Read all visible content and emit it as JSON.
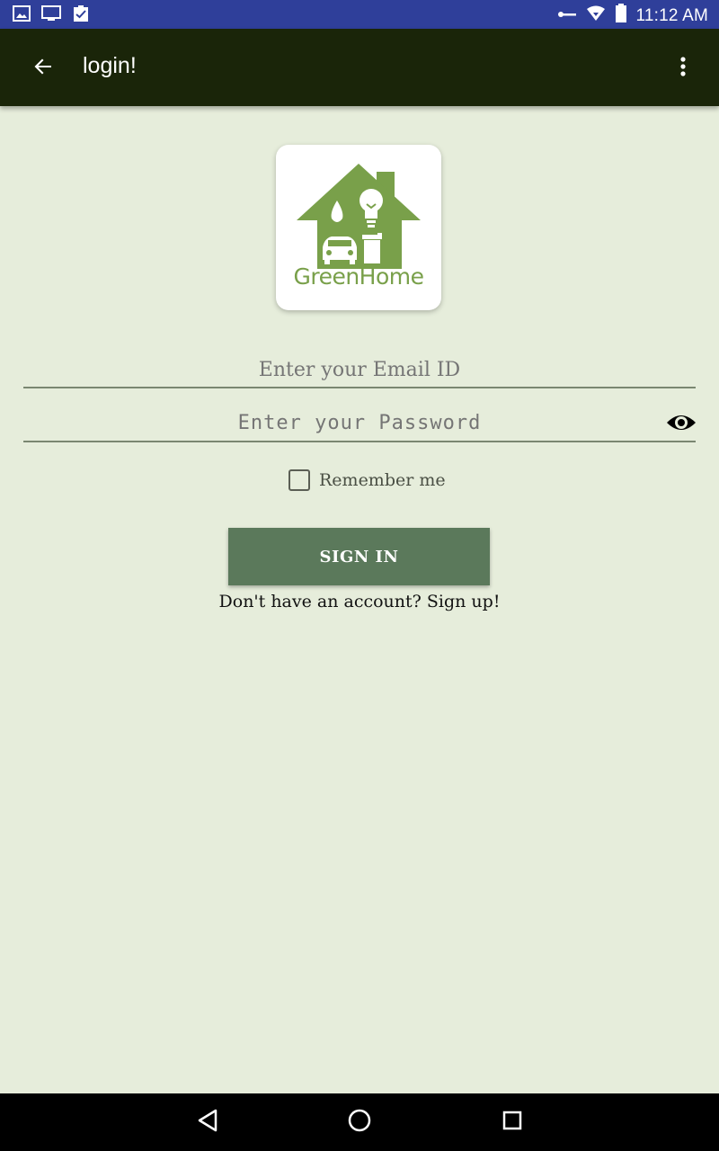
{
  "status_bar": {
    "time": "11:12 AM",
    "left_icons": [
      "image-icon",
      "monitor-icon",
      "clipboard-check-icon"
    ],
    "right_icons": [
      "key-icon",
      "wifi-icon",
      "battery-icon"
    ]
  },
  "app_bar": {
    "title": "login!",
    "back_icon": "arrow-left-icon",
    "menu_icon": "more-vert-icon"
  },
  "logo": {
    "text": "GreenHome",
    "color": "#79a04a"
  },
  "form": {
    "email_placeholder": "Enter your Email ID",
    "password_placeholder": "Enter your Password",
    "remember_label": "Remember me",
    "sign_in_label": "SIGN IN",
    "signup_link": "Don't have an account? Sign up!"
  },
  "colors": {
    "status_bar": "#2f3f9a",
    "app_bar": "#1a2509",
    "background": "#e6eddb",
    "button": "#5b795b"
  },
  "nav_bar": {
    "icons": [
      "back-triangle-icon",
      "home-circle-icon",
      "recents-square-icon"
    ]
  }
}
